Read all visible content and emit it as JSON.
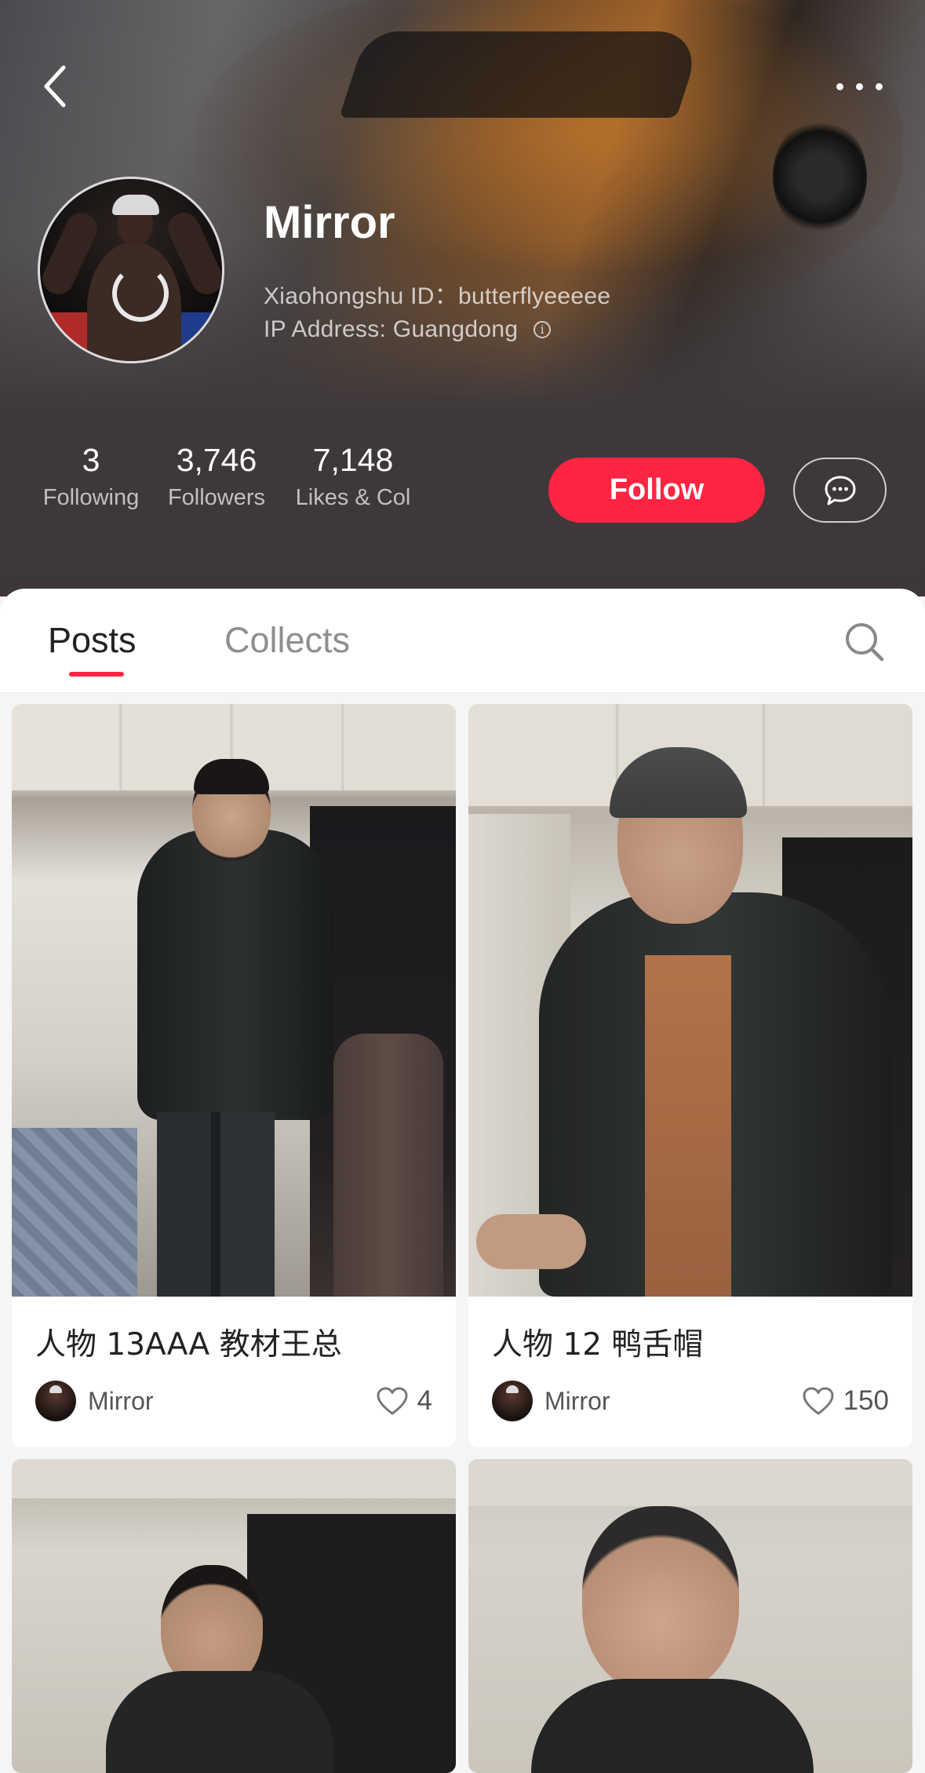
{
  "profile": {
    "username": "Mirror",
    "id_line": "Xiaohongshu ID：butterflyeeeee",
    "ip_line": "IP Address: Guangdong"
  },
  "stats": {
    "following": {
      "value": "3",
      "label": "Following"
    },
    "followers": {
      "value": "3,746",
      "label": "Followers"
    },
    "likes": {
      "value": "7,148",
      "label": "Likes & Col"
    }
  },
  "actions": {
    "follow_label": "Follow"
  },
  "tabs": [
    {
      "label": "Posts",
      "active": true
    },
    {
      "label": "Collects",
      "active": false
    }
  ],
  "posts": [
    {
      "title": "人物 13AAA 教材王总",
      "author": "Mirror",
      "likes": "4"
    },
    {
      "title": "人物 12 鸭舌帽",
      "author": "Mirror",
      "likes": "150"
    },
    {
      "title": "",
      "author": "",
      "likes": ""
    },
    {
      "title": "",
      "author": "",
      "likes": ""
    }
  ],
  "icons": {
    "back": "chevron-left-icon",
    "more": "more-dots-icon",
    "info": "info-icon",
    "message": "chat-bubble-icon",
    "search": "search-icon",
    "like": "heart-outline-icon"
  },
  "colors": {
    "accent": "#ff2442",
    "header_bg": "#3d3739"
  }
}
